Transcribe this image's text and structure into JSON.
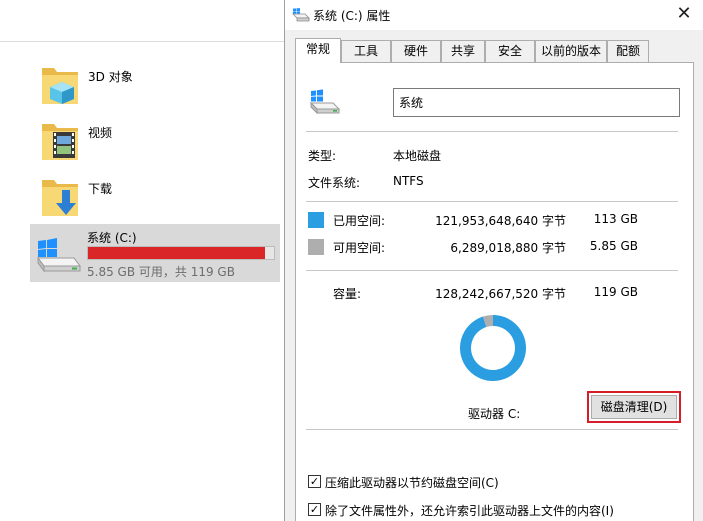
{
  "explorer": {
    "items": [
      {
        "name": "3D 对象"
      },
      {
        "name": "视频"
      },
      {
        "name": "下载"
      }
    ],
    "drive": {
      "name": "系统 (C:)",
      "used_fraction": 0.95,
      "summary": "5.85 GB 可用，共 119 GB"
    },
    "colors": {
      "selected_bg": "#d9d9d9",
      "usage_bar": "#da2626"
    }
  },
  "dialog": {
    "title": "系统 (C:) 属性",
    "close_glyph": "✕",
    "tabs": [
      {
        "label": "常规",
        "active": true
      },
      {
        "label": "工具"
      },
      {
        "label": "硬件"
      },
      {
        "label": "共享"
      },
      {
        "label": "安全"
      },
      {
        "label": "以前的版本"
      },
      {
        "label": "配额"
      }
    ],
    "general": {
      "volume_name": "系统",
      "type_label": "类型:",
      "type_value": "本地磁盘",
      "fs_label": "文件系统:",
      "fs_value": "NTFS",
      "used": {
        "label": "已用空间:",
        "bytes": "121,953,648,640 字节",
        "size": "113 GB",
        "color": "#2a9ee1"
      },
      "free": {
        "label": "可用空间:",
        "bytes": "6,289,018,880 字节",
        "size": "5.85 GB",
        "color": "#aeaeae"
      },
      "capacity": {
        "label": "容量:",
        "bytes": "128,242,667,520 字节",
        "size": "119 GB"
      },
      "drive_label": "驱动器 C:",
      "cleanup_button": "磁盘清理(D)",
      "options": [
        {
          "label": "压缩此驱动器以节约磁盘空间(C)",
          "checked": true
        },
        {
          "label": "除了文件属性外，还允许索引此驱动器上文件的内容(I)",
          "checked": true
        }
      ],
      "check_glyph": "✓"
    }
  },
  "chart_data": {
    "type": "pie",
    "categories": [
      "已用空间",
      "可用空间"
    ],
    "values": [
      121953648640,
      6289018880
    ],
    "colors": [
      "#2a9ee1",
      "#aeaeae"
    ]
  }
}
